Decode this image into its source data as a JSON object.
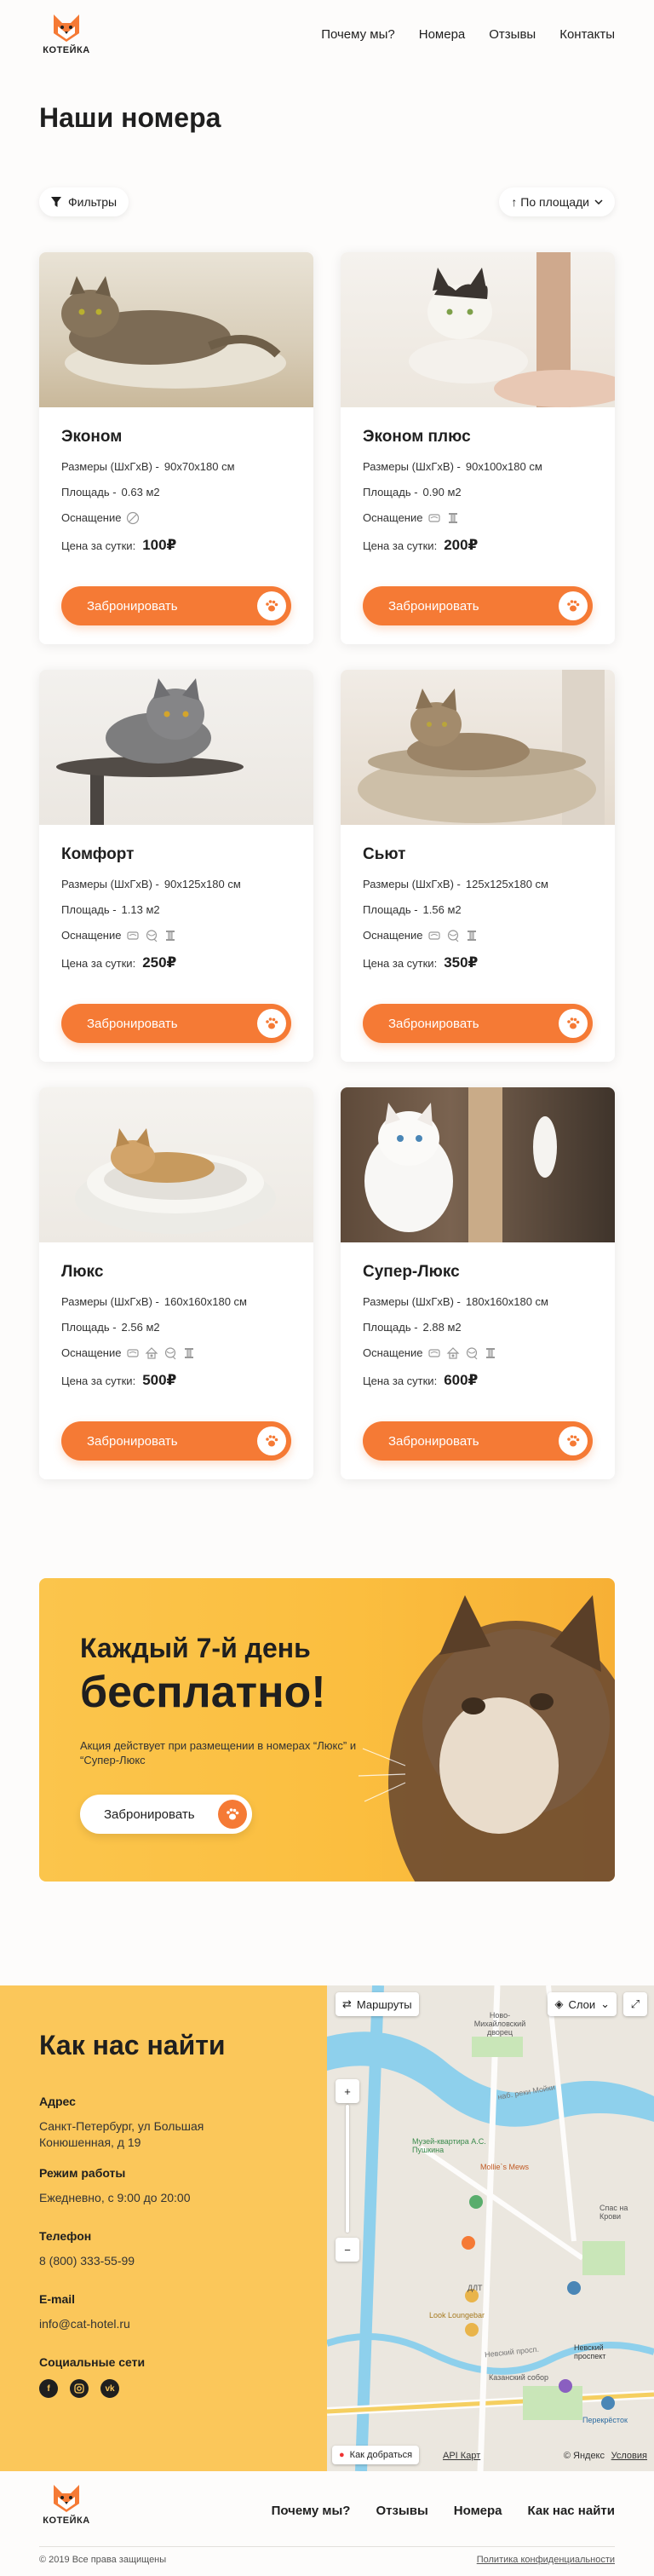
{
  "brand": {
    "name": "КОТЕЙКА"
  },
  "nav": {
    "items": [
      "Почему мы?",
      "Номера",
      "Отзывы",
      "Контакты"
    ]
  },
  "page_title": "Наши номера",
  "toolbar": {
    "filter_label": "Фильтры",
    "sort_label": "↑ По площади"
  },
  "labels": {
    "sizes": "Размеры (ШхГхВ) - ",
    "area": "Площадь - ",
    "equipment": "Оснащение",
    "price": "Цена за сутки:",
    "book": "Забронировать"
  },
  "rooms": [
    {
      "name": "Эконом",
      "sizes": "90x70x180 см",
      "area": "0.63 м2",
      "price": "100₽",
      "amenities": [
        "none-icon"
      ]
    },
    {
      "name": "Эконом плюс",
      "sizes": "90x100x180 см",
      "area": "0.90 м2",
      "price": "200₽",
      "amenities": [
        "bed-icon",
        "scratcher-icon"
      ]
    },
    {
      "name": "Комфорт",
      "sizes": "90x125x180 см",
      "area": "1.13 м2",
      "price": "250₽",
      "amenities": [
        "bed-icon",
        "toy-ball-icon",
        "scratcher-icon"
      ]
    },
    {
      "name": "Сьют",
      "sizes": "125x125x180 см",
      "area": "1.56 м2",
      "price": "350₽",
      "amenities": [
        "bed-icon",
        "toy-ball-icon",
        "scratcher-icon"
      ]
    },
    {
      "name": "Люкс",
      "sizes": "160x160x180 см",
      "area": "2.56 м2",
      "price": "500₽",
      "amenities": [
        "bed-icon",
        "house-icon",
        "toy-ball-icon",
        "scratcher-icon"
      ]
    },
    {
      "name": "Супер-Люкс",
      "sizes": "180x160x180 см",
      "area": "2.88 м2",
      "price": "600₽",
      "amenities": [
        "bed-icon",
        "house-icon",
        "toy-ball-icon",
        "scratcher-icon"
      ]
    }
  ],
  "promo": {
    "line1": "Каждый 7-й день",
    "line2": "бесплатно!",
    "desc": "Акция действует при размещении в номерах “Люкс” и “Супер-Люкс",
    "button": "Забронировать"
  },
  "contacts": {
    "title": "Как нас найти",
    "address_label": "Адрес",
    "address": "Санкт-Петербург, ул Большая Конюшенная, д 19",
    "hours_label": "Режим работы",
    "hours": "Ежедневно, с 9:00 до 20:00",
    "phone_label": "Телефон",
    "phone": "8 (800) 333-55-99",
    "email_label": "E-mail",
    "email": "info@cat-hotel.ru",
    "social_label": "Социальные сети"
  },
  "map": {
    "routes": "Маршруты",
    "layers": "Слои",
    "directions": "Как добраться",
    "api": "API Карт",
    "yandex": "© Яндекс",
    "terms": "Условия",
    "labels": [
      "Ново-Михайловский дворец",
      "Музей-квартира А.С. Пушкина",
      "Mollie`s Mews",
      "Look Loungebar",
      "Невский проспект",
      "Казанский собор",
      "Перекрёсток",
      "ДЛТ",
      "Спас на Крови",
      "Невский просп.",
      "наб. реки Мойки"
    ]
  },
  "footer": {
    "nav": [
      "Почему мы?",
      "Отзывы",
      "Номера",
      "Как нас найти"
    ],
    "copyright": "© 2019 Все права защищены",
    "privacy": "Политика конфиденциальности"
  }
}
